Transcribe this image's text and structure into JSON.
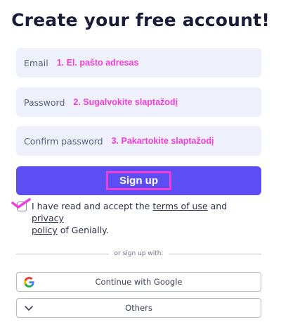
{
  "header": {
    "title": "Create your free account!"
  },
  "form": {
    "email": {
      "placeholder": "Email",
      "annotation": "1. El. pašto adresas"
    },
    "password": {
      "placeholder": "Password",
      "annotation": "2. Sugalvokite slaptažodį"
    },
    "confirm": {
      "placeholder": "Confirm password",
      "annotation": "3. Pakartokite slaptažodį"
    },
    "signup_label": "Sign up",
    "terms": {
      "prefix": "I have read and accept the ",
      "terms_link": "terms of use",
      "middle": " and ",
      "privacy_link_part1": "privacy",
      "privacy_link_part2": "policy",
      "suffix": " of Genially."
    }
  },
  "alt_signup": {
    "divider_text": "or sign up with:",
    "google_label": "Continue with Google",
    "others_label": "Others"
  },
  "icons": {
    "google": "google-icon",
    "others": "chevron-down-icon",
    "check": "checkmark-icon"
  },
  "colors": {
    "accent": "#5c4ef2",
    "annotation": "#f03ed6",
    "field_bg": "#eef0fb",
    "title": "#1a1d3a"
  }
}
